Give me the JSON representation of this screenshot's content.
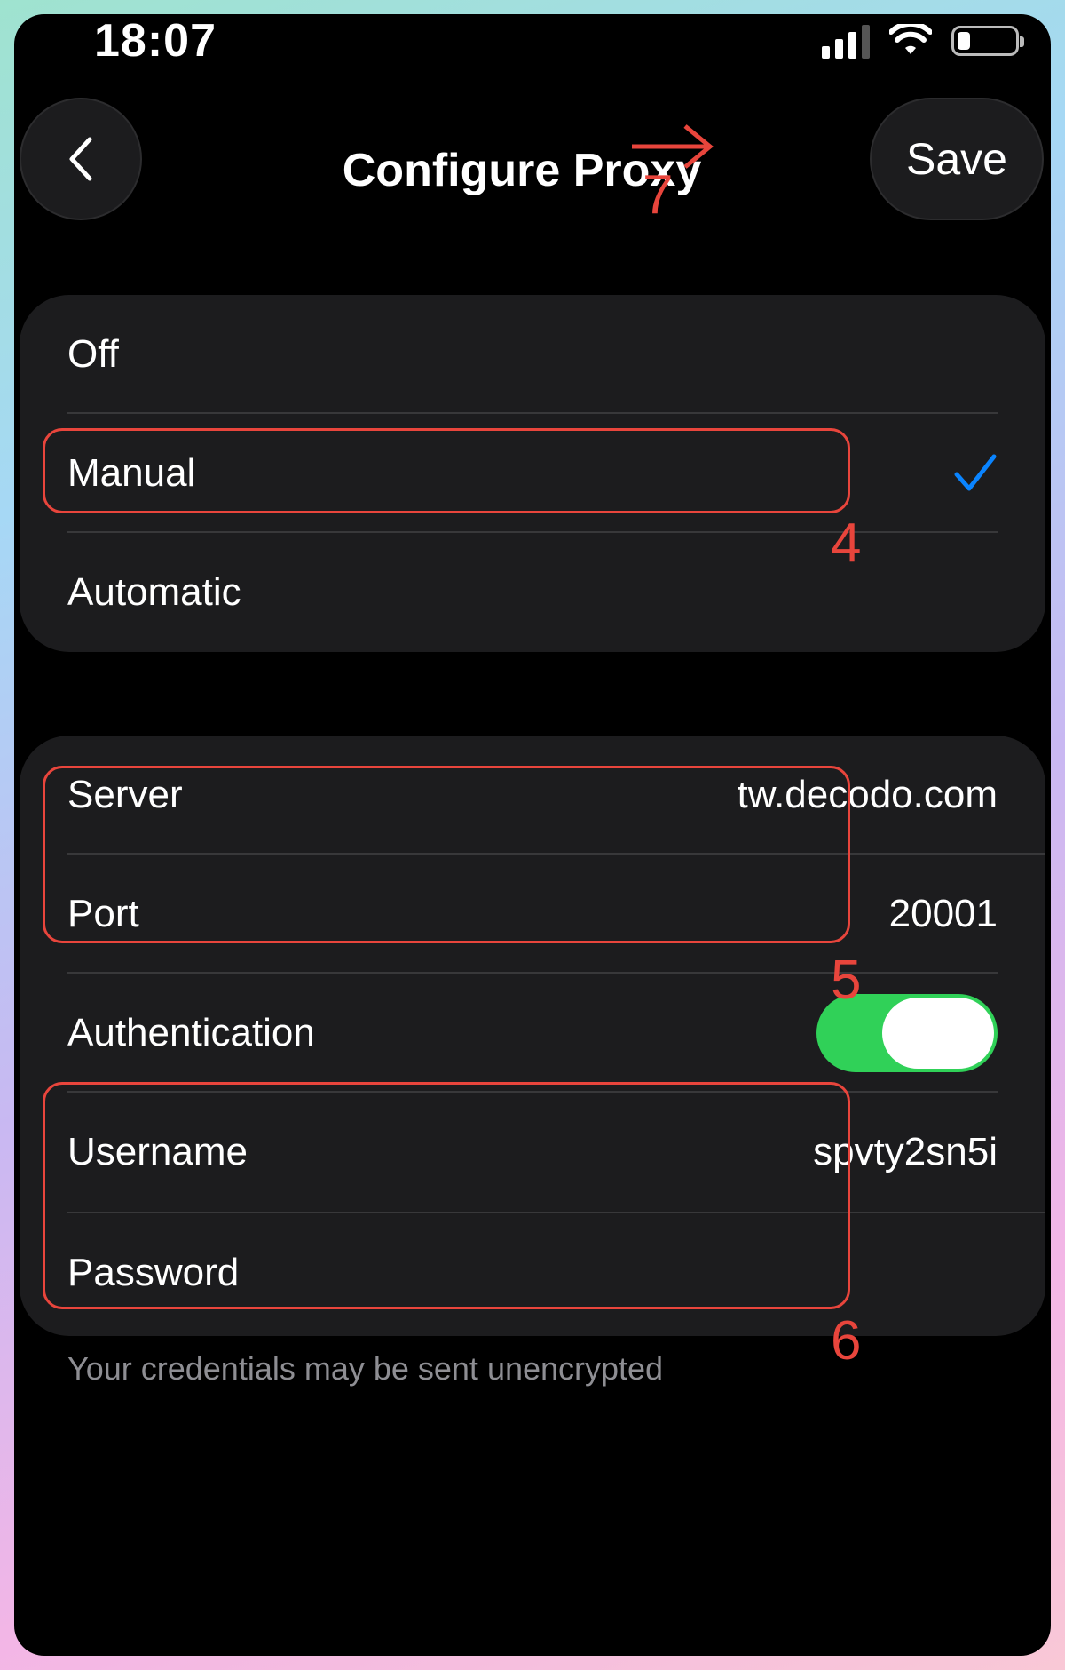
{
  "status_bar": {
    "time": "18:07",
    "icons": [
      "signal-icon",
      "wifi-icon",
      "battery-icon"
    ],
    "battery_level": 0.2
  },
  "nav": {
    "title": "Configure Proxy",
    "save_label": "Save",
    "back_icon": "chevron-left-icon"
  },
  "mode_options": {
    "items": [
      {
        "label": "Off",
        "selected": false
      },
      {
        "label": "Manual",
        "selected": true
      },
      {
        "label": "Automatic",
        "selected": false
      }
    ],
    "check_color": "#0a84ff"
  },
  "settings": {
    "server": {
      "label": "Server",
      "value": "tw.decodo.com"
    },
    "port": {
      "label": "Port",
      "value": "20001"
    },
    "authentication": {
      "label": "Authentication",
      "enabled": true,
      "toggle_color": "#30d158"
    },
    "username": {
      "label": "Username",
      "value": "spvty2sn5i"
    },
    "password": {
      "label": "Password",
      "value": ""
    }
  },
  "footnote": "Your credentials may be sent unencrypted",
  "annotations": {
    "color": "#e8453c",
    "step_manual": "4",
    "step_server_port": "5",
    "step_credentials": "6",
    "step_save": "7"
  }
}
